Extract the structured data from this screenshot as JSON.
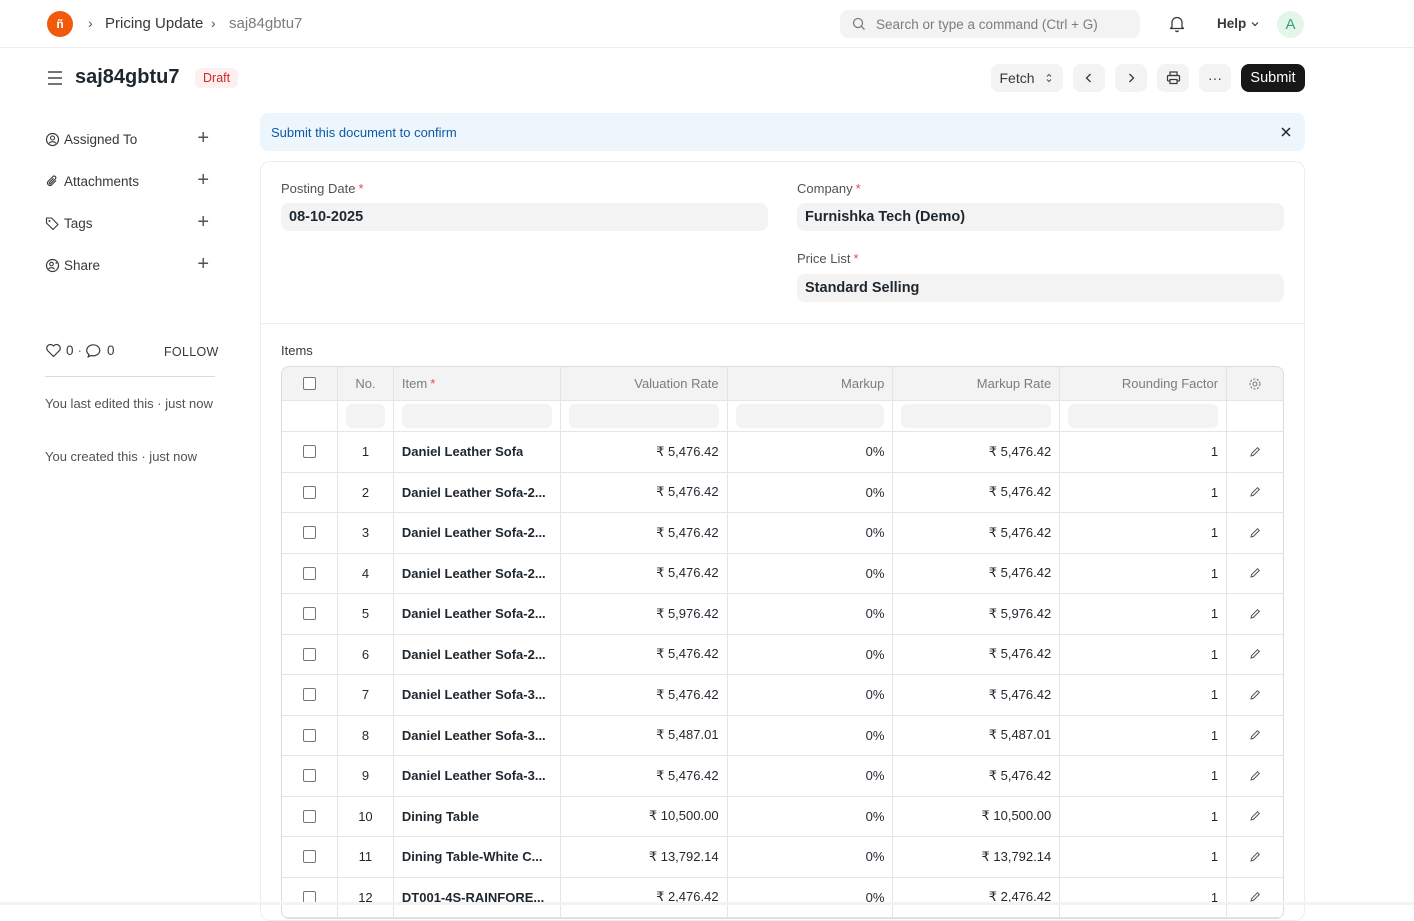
{
  "navbar": {
    "logo_text": "ñ",
    "breadcrumbs": [
      "Pricing Update",
      "saj84gbtu7"
    ],
    "search_placeholder": "Search or type a command (Ctrl + G)",
    "help_label": "Help",
    "avatar_letter": "A"
  },
  "page": {
    "title": "saj84gbtu7",
    "status": "Draft",
    "fetch_label": "Fetch",
    "submit_label": "Submit",
    "more_label": "···"
  },
  "sidebar": {
    "items": [
      {
        "label": "Assigned To",
        "icon": "assign-icon"
      },
      {
        "label": "Attachments",
        "icon": "paperclip-icon"
      },
      {
        "label": "Tags",
        "icon": "tag-icon"
      },
      {
        "label": "Share",
        "icon": "share-icon"
      }
    ],
    "likes": "0",
    "comments": "0",
    "follow_label": "FOLLOW",
    "last_edited": "You last edited this · just now",
    "created": "You created this · just now"
  },
  "alert": {
    "message": "Submit this document to confirm"
  },
  "form": {
    "posting_date_label": "Posting Date",
    "posting_date": "08-10-2025",
    "company_label": "Company",
    "company": "Furnishka Tech (Demo)",
    "price_list_label": "Price List",
    "price_list": "Standard Selling"
  },
  "items": {
    "label": "Items",
    "columns": {
      "no": "No.",
      "item": "Item",
      "valuation_rate": "Valuation Rate",
      "markup": "Markup",
      "markup_rate": "Markup Rate",
      "rounding_factor": "Rounding Factor"
    },
    "rows": [
      {
        "no": "1",
        "item": "Daniel Leather Sofa",
        "valuation_rate": "₹ 5,476.42",
        "markup": "0%",
        "markup_rate": "₹ 5,476.42",
        "rounding_factor": "1"
      },
      {
        "no": "2",
        "item": "Daniel Leather Sofa-2...",
        "valuation_rate": "₹ 5,476.42",
        "markup": "0%",
        "markup_rate": "₹ 5,476.42",
        "rounding_factor": "1"
      },
      {
        "no": "3",
        "item": "Daniel Leather Sofa-2...",
        "valuation_rate": "₹ 5,476.42",
        "markup": "0%",
        "markup_rate": "₹ 5,476.42",
        "rounding_factor": "1"
      },
      {
        "no": "4",
        "item": "Daniel Leather Sofa-2...",
        "valuation_rate": "₹ 5,476.42",
        "markup": "0%",
        "markup_rate": "₹ 5,476.42",
        "rounding_factor": "1"
      },
      {
        "no": "5",
        "item": "Daniel Leather Sofa-2...",
        "valuation_rate": "₹ 5,976.42",
        "markup": "0%",
        "markup_rate": "₹ 5,976.42",
        "rounding_factor": "1"
      },
      {
        "no": "6",
        "item": "Daniel Leather Sofa-2...",
        "valuation_rate": "₹ 5,476.42",
        "markup": "0%",
        "markup_rate": "₹ 5,476.42",
        "rounding_factor": "1"
      },
      {
        "no": "7",
        "item": "Daniel Leather Sofa-3...",
        "valuation_rate": "₹ 5,476.42",
        "markup": "0%",
        "markup_rate": "₹ 5,476.42",
        "rounding_factor": "1"
      },
      {
        "no": "8",
        "item": "Daniel Leather Sofa-3...",
        "valuation_rate": "₹ 5,487.01",
        "markup": "0%",
        "markup_rate": "₹ 5,487.01",
        "rounding_factor": "1"
      },
      {
        "no": "9",
        "item": "Daniel Leather Sofa-3...",
        "valuation_rate": "₹ 5,476.42",
        "markup": "0%",
        "markup_rate": "₹ 5,476.42",
        "rounding_factor": "1"
      },
      {
        "no": "10",
        "item": "Dining Table",
        "valuation_rate": "₹ 10,500.00",
        "markup": "0%",
        "markup_rate": "₹ 10,500.00",
        "rounding_factor": "1"
      },
      {
        "no": "11",
        "item": "Dining Table-White C...",
        "valuation_rate": "₹ 13,792.14",
        "markup": "0%",
        "markup_rate": "₹ 13,792.14",
        "rounding_factor": "1"
      },
      {
        "no": "12",
        "item": "DT001-4S-RAINFORE...",
        "valuation_rate": "₹ 2,476.42",
        "markup": "0%",
        "markup_rate": "₹ 2,476.42",
        "rounding_factor": "1"
      }
    ]
  },
  "colors": {
    "brand": "#f05a0a",
    "draft_badge_bg": "#fff0f0",
    "draft_badge_text": "#cc2929",
    "alert_bg": "#edf6fd",
    "alert_text": "#0c5aa6",
    "primary_button": "#171717"
  }
}
